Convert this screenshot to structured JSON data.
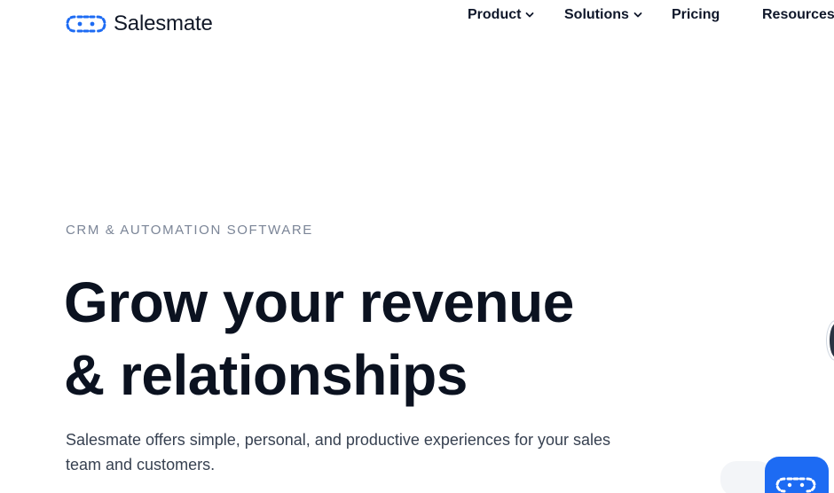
{
  "brand": {
    "name": "Salesmate",
    "accent": "#1d6bf3"
  },
  "nav": {
    "items": [
      {
        "label": "Product",
        "has_dropdown": true
      },
      {
        "label": "Solutions",
        "has_dropdown": true
      },
      {
        "label": "Pricing",
        "has_dropdown": false
      },
      {
        "label": "Resources",
        "has_dropdown": false
      }
    ]
  },
  "hero": {
    "eyebrow": "CRM & AUTOMATION SOFTWARE",
    "headline_line1": "Grow your revenue",
    "headline_line2": "& relationships",
    "subtext": "Salesmate offers simple, personal, and productive experiences for your sales team and customers."
  },
  "icons": {
    "logo": "salesmate-logo-icon",
    "dropdown": "chevron-down-icon",
    "chat": "chat-launcher-icon"
  }
}
